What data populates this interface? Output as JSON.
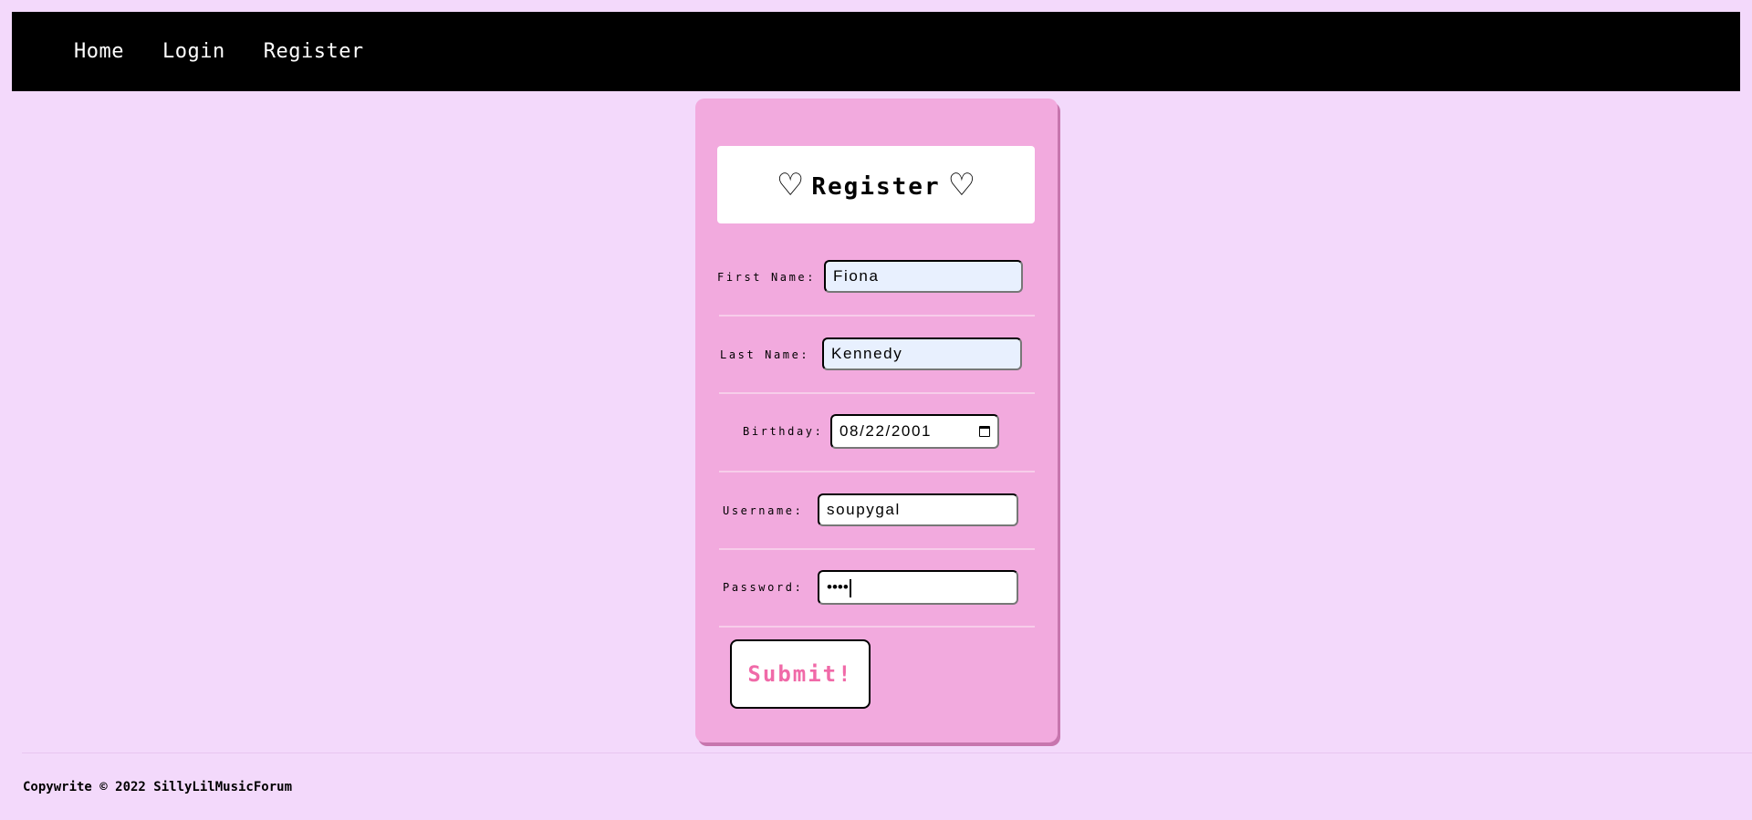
{
  "nav": {
    "home": "Home",
    "login": "Login",
    "register": "Register"
  },
  "form": {
    "title": "Register",
    "heart_icon": "♡",
    "first_name": {
      "label": "First Name:",
      "value": "Fiona"
    },
    "last_name": {
      "label": "Last Name:",
      "value": "Kennedy"
    },
    "birthday": {
      "label": "Birthday:",
      "value": "08/22/2001",
      "icon": "calendar-icon"
    },
    "username": {
      "label": "Username:",
      "value": "soupygal"
    },
    "password": {
      "label": "Password:",
      "value": "••••"
    },
    "submit_label": "Submit!"
  },
  "footer": {
    "text": "Copywrite © 2022 SillyLilMusicForum"
  },
  "colors": {
    "background": "#f3d9fb",
    "nav": "#000000",
    "card": "#f2aade",
    "submit_text": "#f06aa8",
    "autofill": "#e8f0fe"
  }
}
